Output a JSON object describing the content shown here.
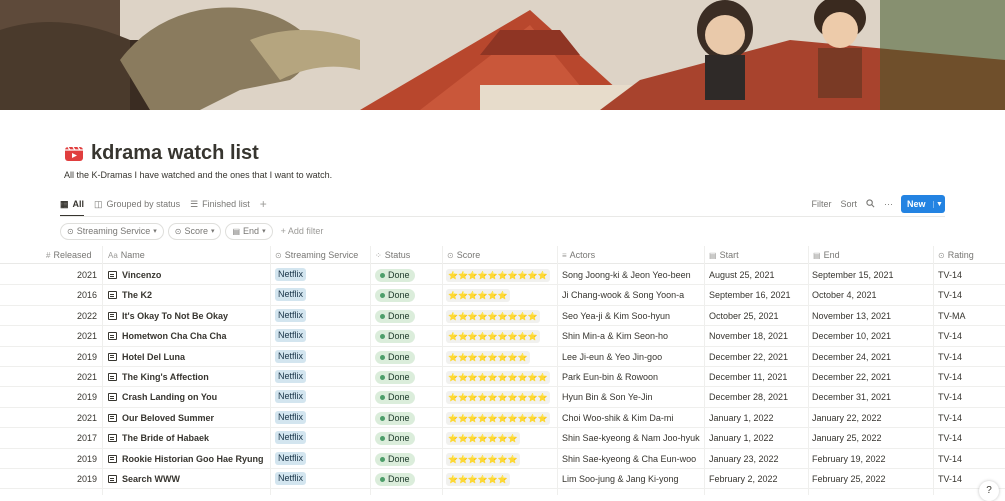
{
  "page": {
    "title": "kdrama watch list",
    "icon": "film-clapper-icon",
    "description": "All the K-Dramas I have watched and the ones that I want to watch."
  },
  "views": {
    "tabs": [
      {
        "label": "All",
        "icon": "table-icon",
        "active": true
      },
      {
        "label": "Grouped by status",
        "icon": "board-icon",
        "active": false
      },
      {
        "label": "Finished list",
        "icon": "list-icon",
        "active": false
      }
    ],
    "add_view": "+"
  },
  "toolbar": {
    "filter": "Filter",
    "sort": "Sort",
    "search_icon": "search-icon",
    "more": "···",
    "new_label": "New",
    "new_caret": "⌄"
  },
  "filters": {
    "chips": [
      {
        "label": "Streaming Service",
        "icon": "select-icon"
      },
      {
        "label": "Score",
        "icon": "select-icon"
      },
      {
        "label": "End",
        "icon": "calendar-icon"
      }
    ],
    "add_filter": "+ Add filter"
  },
  "table": {
    "headers": {
      "released": "Released",
      "released_icon": "#",
      "name": "Name",
      "name_icon": "Aa",
      "service": "Streaming Service",
      "status": "Status",
      "score": "Score",
      "actors": "Actors",
      "start": "Start",
      "end": "End",
      "rating": "Rating"
    },
    "rows": [
      {
        "released": "2021",
        "name": "Vincenzo",
        "service": "Netflix",
        "status": "Done",
        "score": "⭐⭐⭐⭐⭐⭐⭐⭐⭐⭐",
        "actors": "Song Joong-ki & Jeon Yeo-been",
        "start": "August 25, 2021",
        "end": "September 15, 2021",
        "rating": "TV-14"
      },
      {
        "released": "2016",
        "name": "The K2",
        "service": "Netflix",
        "status": "Done",
        "score": "⭐⭐⭐⭐⭐⭐",
        "actors": "Ji Chang-wook & Song Yoon-a",
        "start": "September 16, 2021",
        "end": "October 4, 2021",
        "rating": "TV-14"
      },
      {
        "released": "2022",
        "name": "It's Okay To Not Be Okay",
        "service": "Netflix",
        "status": "Done",
        "score": "⭐⭐⭐⭐⭐⭐⭐⭐⭐",
        "actors": "Seo Yea-ji & Kim Soo-hyun",
        "start": "October 25, 2021",
        "end": "November 13, 2021",
        "rating": "TV-MA"
      },
      {
        "released": "2021",
        "name": "Hometwon Cha Cha Cha",
        "service": "Netflix",
        "status": "Done",
        "score": "⭐⭐⭐⭐⭐⭐⭐⭐⭐",
        "actors": "Shin Min-a & Kim Seon-ho",
        "start": "November 18, 2021",
        "end": "December 10, 2021",
        "rating": "TV-14"
      },
      {
        "released": "2019",
        "name": "Hotel Del Luna",
        "service": "Netflix",
        "status": "Done",
        "score": "⭐⭐⭐⭐⭐⭐⭐⭐",
        "actors": "Lee Ji-eun & Yeo Jin-goo",
        "start": "December 22, 2021",
        "end": "December 24, 2021",
        "rating": "TV-14"
      },
      {
        "released": "2021",
        "name": "The King's Affection",
        "service": "Netflix",
        "status": "Done",
        "score": "⭐⭐⭐⭐⭐⭐⭐⭐⭐⭐",
        "actors": "Park Eun-bin & Rowoon",
        "start": "December 11, 2021",
        "end": "December 22, 2021",
        "rating": "TV-14"
      },
      {
        "released": "2019",
        "name": "Crash Landing on You",
        "service": "Netflix",
        "status": "Done",
        "score": "⭐⭐⭐⭐⭐⭐⭐⭐⭐⭐",
        "actors": "Hyun Bin & Son Ye-Jin",
        "start": "December 28, 2021",
        "end": "December 31, 2021",
        "rating": "TV-14"
      },
      {
        "released": "2021",
        "name": "Our Beloved Summer",
        "service": "Netflix",
        "status": "Done",
        "score": "⭐⭐⭐⭐⭐⭐⭐⭐⭐⭐",
        "actors": "Choi Woo-shik & Kim Da-mi",
        "start": "January 1, 2022",
        "end": "January 22, 2022",
        "rating": "TV-14"
      },
      {
        "released": "2017",
        "name": "The Bride of Habaek",
        "service": "Netflix",
        "status": "Done",
        "score": "⭐⭐⭐⭐⭐⭐⭐",
        "actors": "Shin Sae-kyeong & Nam Joo-hyuk",
        "start": "January 1, 2022",
        "end": "January 25, 2022",
        "rating": "TV-14"
      },
      {
        "released": "2019",
        "name": "Rookie Historian Goo Hae Ryung",
        "service": "Netflix",
        "status": "Done",
        "score": "⭐⭐⭐⭐⭐⭐⭐",
        "actors": "Shin Sae-kyeong & Cha Eun-woo",
        "start": "January 23, 2022",
        "end": "February 19, 2022",
        "rating": "TV-14"
      },
      {
        "released": "2019",
        "name": "Search WWW",
        "service": "Netflix",
        "status": "Done",
        "score": "⭐⭐⭐⭐⭐⭐",
        "actors": "Lim Soo-jung & Jang Ki-yong",
        "start": "February 2, 2022",
        "end": "February 25, 2022",
        "rating": "TV-14"
      }
    ]
  },
  "help": "?"
}
